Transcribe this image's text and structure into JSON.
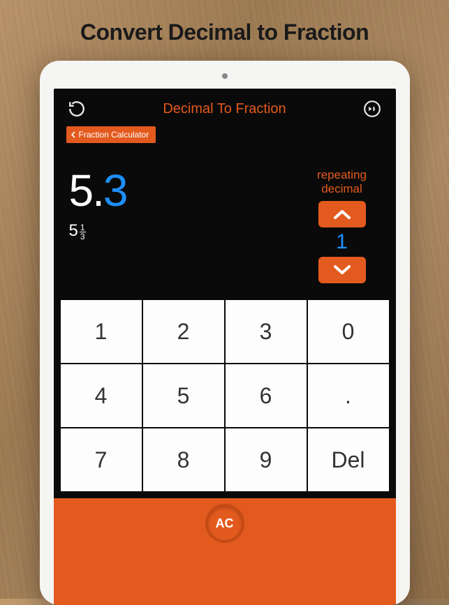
{
  "marketing": {
    "title": "Convert Decimal to Fraction"
  },
  "header": {
    "title": "Decimal To Fraction",
    "reset_icon": "reset-icon",
    "sound_icon": "sound-icon"
  },
  "back": {
    "label": "Fraction Calculator"
  },
  "display": {
    "integer_part": "5.",
    "decimal_part": "3",
    "mixed_whole": "5",
    "mixed_numerator": "1",
    "mixed_denominator": "3"
  },
  "repeating": {
    "label_line1": "repeating",
    "label_line2": "decimal",
    "value": "1"
  },
  "keypad": {
    "keys": [
      "1",
      "2",
      "3",
      "0",
      "4",
      "5",
      "6",
      ".",
      "7",
      "8",
      "9",
      "Del"
    ]
  },
  "footer": {
    "ac_label": "AC"
  }
}
